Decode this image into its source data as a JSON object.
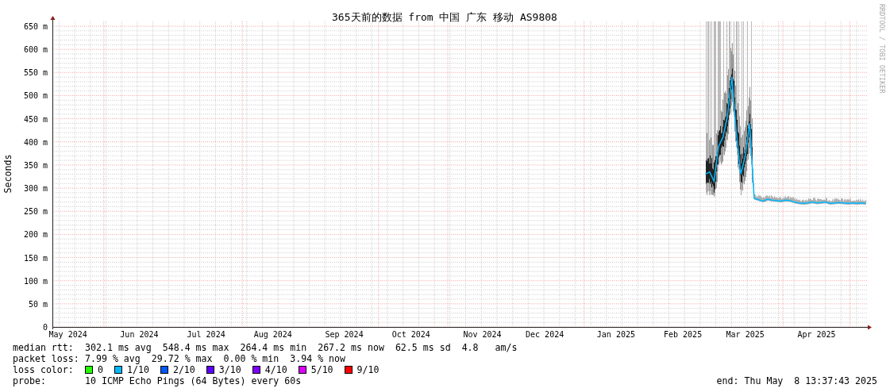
{
  "title": "365天前的数据 from 中国 广东 移动 AS9808",
  "credit": "RRDTOOL / TOBI OETIKER",
  "chart_data": {
    "type": "line",
    "grid": true,
    "ylabel": "Seconds",
    "ylim": [
      0,
      650
    ],
    "yticks": [
      {
        "value": 0,
        "label": "0"
      },
      {
        "value": 50,
        "label": "50 m"
      },
      {
        "value": 100,
        "label": "100 m"
      },
      {
        "value": 150,
        "label": "150 m"
      },
      {
        "value": 200,
        "label": "200 m"
      },
      {
        "value": 250,
        "label": "250 m"
      },
      {
        "value": 300,
        "label": "300 m"
      },
      {
        "value": 350,
        "label": "350 m"
      },
      {
        "value": 400,
        "label": "400 m"
      },
      {
        "value": 450,
        "label": "450 m"
      },
      {
        "value": 500,
        "label": "500 m"
      },
      {
        "value": 550,
        "label": "550 m"
      },
      {
        "value": 600,
        "label": "600 m"
      },
      {
        "value": 650,
        "label": "650 m"
      }
    ],
    "categories": [
      null,
      null,
      null,
      "May 2024",
      null,
      null,
      null,
      null,
      null,
      null,
      null,
      null,
      null,
      null,
      null,
      null,
      null,
      null,
      null,
      "Jun 2024",
      null,
      null,
      null,
      null,
      null,
      null,
      null,
      null,
      null,
      null,
      null,
      null,
      null,
      null,
      "Jul 2024",
      null,
      null,
      null,
      null,
      null,
      null,
      null,
      null,
      null,
      null,
      null,
      null,
      null,
      null,
      "Aug 2024",
      null,
      null,
      null,
      null,
      null,
      null,
      null,
      null,
      null,
      null,
      null,
      null,
      null,
      null,
      null,
      "Sep 2024",
      null,
      null,
      null,
      null,
      null,
      null,
      null,
      null,
      null,
      null,
      null,
      null,
      null,
      null,
      "Oct 2024",
      null,
      null,
      null,
      null,
      null,
      null,
      null,
      null,
      null,
      null,
      null,
      null,
      null,
      null,
      null,
      "Nov 2024",
      null,
      null,
      null,
      null,
      null,
      null,
      null,
      null,
      null,
      null,
      null,
      null,
      null,
      "Dec 2024",
      null,
      null,
      null,
      null,
      null,
      null,
      null,
      null,
      null,
      null,
      null,
      null,
      null,
      null,
      null,
      "Jan 2025",
      null,
      null,
      null,
      null,
      null,
      null,
      null,
      null,
      null,
      null,
      null,
      null,
      null,
      null,
      "Feb 2025",
      null,
      null,
      null,
      null,
      null,
      null,
      null,
      null,
      null,
      null,
      null,
      null,
      null,
      "Mar 2025",
      null,
      null,
      null,
      null,
      null,
      null,
      null,
      null,
      null,
      null,
      null,
      null,
      null,
      null,
      null,
      "Apr 2025",
      null,
      null,
      null,
      null,
      null,
      null,
      null,
      null,
      null,
      null,
      null
    ],
    "series": [
      {
        "color": "#00b8ff",
        "values": [
          null,
          null,
          null,
          null,
          null,
          null,
          null,
          null,
          null,
          null,
          null,
          null,
          null,
          null,
          null,
          null,
          null,
          null,
          null,
          null,
          null,
          null,
          null,
          null,
          null,
          null,
          null,
          null,
          null,
          null,
          null,
          null,
          null,
          null,
          null,
          null,
          null,
          null,
          null,
          null,
          null,
          null,
          null,
          null,
          null,
          null,
          null,
          null,
          null,
          null,
          null,
          null,
          null,
          null,
          null,
          null,
          null,
          null,
          null,
          null,
          null,
          null,
          null,
          null,
          null,
          null,
          null,
          null,
          null,
          null,
          null,
          null,
          null,
          null,
          null,
          null,
          null,
          null,
          null,
          null,
          null,
          null,
          null,
          null,
          null,
          null,
          null,
          null,
          null,
          null,
          null,
          null,
          null,
          null,
          null,
          null,
          null,
          null,
          null,
          null,
          null,
          null,
          null,
          null,
          null,
          null,
          null,
          null,
          null,
          null,
          null,
          null,
          null,
          null,
          null,
          null,
          null,
          null,
          null,
          null,
          null,
          null,
          null,
          null,
          null,
          null,
          null,
          null,
          null,
          null,
          null,
          null,
          null,
          null,
          null,
          null,
          null,
          null,
          null,
          null,
          null,
          null,
          null,
          null,
          null,
          null,
          330,
          335,
          315,
          390,
          410,
          455,
          540,
          420,
          330,
          370,
          440,
          278,
          275,
          272,
          276,
          274,
          273,
          272,
          274,
          273,
          270,
          268,
          267,
          268,
          270,
          268,
          269,
          270,
          267,
          268,
          269,
          268,
          267,
          268,
          267,
          268,
          267
        ]
      }
    ]
  },
  "legend": {
    "stats": [
      {
        "label": "median rtt:",
        "text": "302.1 ms avg  548.4 ms max  264.4 ms min  267.2 ms now  62.5 ms sd  4.8   am/s"
      },
      {
        "label": "packet loss:",
        "text": "7.99 % avg  29.72 % max  0.00 % min  3.94 % now"
      }
    ],
    "loss_colors": {
      "label": "loss color:",
      "items": [
        {
          "label": "0",
          "color": "#26ff00"
        },
        {
          "label": "1/10",
          "color": "#00b8ff"
        },
        {
          "label": "2/10",
          "color": "#0059ff"
        },
        {
          "label": "3/10",
          "color": "#5e00ff"
        },
        {
          "label": "4/10",
          "color": "#7e00ff"
        },
        {
          "label": "5/10",
          "color": "#dd00ff"
        },
        {
          "label": "9/10",
          "color": "#ff0000"
        }
      ]
    },
    "probe": {
      "label": "probe:",
      "text": "10 ICMP Echo Pings (64 Bytes) every 60s"
    },
    "end": "end: Thu May  8 13:37:43 2025"
  }
}
